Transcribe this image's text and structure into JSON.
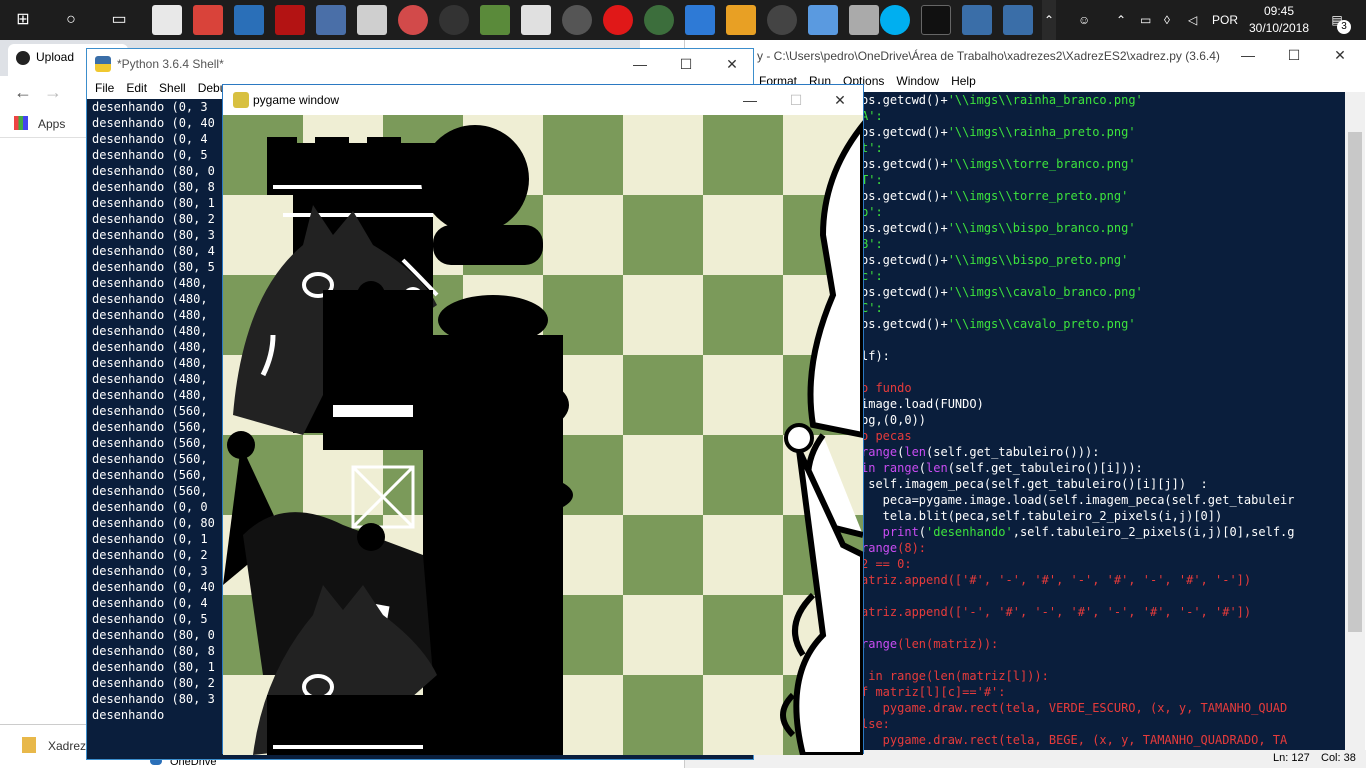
{
  "taskbar": {
    "lang": "POR",
    "time": "09:45",
    "date": "30/10/2018",
    "notifications": "3"
  },
  "chrome": {
    "tab_label": "Upload",
    "bookmarks_apps": "Apps",
    "download_item": "Xadrez",
    "onedrive": "OneDrive"
  },
  "shell": {
    "title": "*Python 3.6.4 Shell*",
    "menu": [
      "File",
      "Edit",
      "Shell",
      "Debu"
    ],
    "lines": [
      "desenhando (0, 3",
      "desenhando (0, 40",
      "desenhando (0, 4",
      "desenhando (0, 5",
      "desenhando (80, 0",
      "desenhando (80, 8",
      "desenhando (80, 1",
      "desenhando (80, 2",
      "desenhando (80, 3",
      "desenhando (80, 4",
      "desenhando (80, 5",
      "desenhando (480,",
      "desenhando (480,",
      "desenhando (480,",
      "desenhando (480,",
      "desenhando (480,",
      "desenhando (480,",
      "desenhando (480,",
      "desenhando (480,",
      "desenhando (560,",
      "desenhando (560,",
      "desenhando (560,",
      "desenhando (560,",
      "desenhando (560,",
      "desenhando (560,",
      "desenhando (0, 0",
      "desenhando (0, 80",
      "desenhando (0, 1",
      "desenhando (0, 2",
      "desenhando (0, 3",
      "desenhando (0, 40",
      "desenhando (0, 4",
      "desenhando (0, 5",
      "desenhando (80, 0",
      "desenhando (80, 8",
      "desenhando (80, 1",
      "desenhando (80, 2",
      "desenhando (80, 3",
      "desenhando"
    ]
  },
  "editor": {
    "title": "y - C:\\Users\\pedro\\OneDrive\\Área de Trabalho\\xadrezes2\\XadrezES2\\xadrez.py (3.6.4)",
    "menu": [
      "Format",
      "Run",
      "Options",
      "Window",
      "Help"
    ],
    "status_ln": "Ln: 127",
    "status_col": "Col: 38",
    "code_lines": [
      [
        [
          "w",
          "os.getcwd()+"
        ],
        [
          "g",
          "'\\\\imgs\\\\rainha_branco.png'"
        ]
      ],
      [
        [
          "g",
          "A':"
        ]
      ],
      [
        [
          "w",
          "os.getcwd()+"
        ],
        [
          "g",
          "'\\\\imgs\\\\rainha_preto.png'"
        ]
      ],
      [
        [
          "g",
          "t':"
        ]
      ],
      [
        [
          "w",
          "os.getcwd()+"
        ],
        [
          "g",
          "'\\\\imgs\\\\torre_branco.png'"
        ]
      ],
      [
        [
          "g",
          "T':"
        ]
      ],
      [
        [
          "w",
          "os.getcwd()+"
        ],
        [
          "g",
          "'\\\\imgs\\\\torre_preto.png'"
        ]
      ],
      [
        [
          "g",
          "b':"
        ]
      ],
      [
        [
          "w",
          "os.getcwd()+"
        ],
        [
          "g",
          "'\\\\imgs\\\\bispo_branco.png'"
        ]
      ],
      [
        [
          "g",
          "B':"
        ]
      ],
      [
        [
          "w",
          "os.getcwd()+"
        ],
        [
          "g",
          "'\\\\imgs\\\\bispo_preto.png'"
        ]
      ],
      [
        [
          "g",
          "c':"
        ]
      ],
      [
        [
          "w",
          "os.getcwd()+"
        ],
        [
          "g",
          "'\\\\imgs\\\\cavalo_branco.png'"
        ]
      ],
      [
        [
          "g",
          "C':"
        ]
      ],
      [
        [
          "w",
          "os.getcwd()+"
        ],
        [
          "g",
          "'\\\\imgs\\\\cavalo_preto.png'"
        ]
      ],
      [
        [
          "w",
          ""
        ]
      ],
      [
        [
          "w",
          "lf):"
        ]
      ],
      [
        [
          "w",
          ""
        ]
      ],
      [
        [
          "r",
          "o fundo"
        ]
      ],
      [
        [
          "w",
          "image.load(FUNDO)"
        ]
      ],
      [
        [
          "w",
          "bg,(0,0))"
        ]
      ],
      [
        [
          "r",
          "o pecas"
        ]
      ],
      [
        [
          "p",
          "range"
        ],
        [
          "w",
          "("
        ],
        [
          "p",
          "len"
        ],
        [
          "w",
          "(self.get_tabuleiro())):"
        ]
      ],
      [
        [
          "p",
          "in range"
        ],
        [
          "w",
          "("
        ],
        [
          "p",
          "len"
        ],
        [
          "w",
          "(self.get_tabuleiro()[i])):"
        ]
      ],
      [
        [
          "w",
          " self.imagem_peca(self.get_tabuleiro()[i][j])  :"
        ]
      ],
      [
        [
          "w",
          "   peca=pygame.image.load(self.imagem_peca(self.get_tabuleir"
        ]
      ],
      [
        [
          "w",
          "   tela.blit(peca,self.tabuleiro_2_pixels(i,j)[0])"
        ]
      ],
      [
        [
          "p",
          "   print"
        ],
        [
          "w",
          "("
        ],
        [
          "g",
          "'desenhando'"
        ],
        [
          "w",
          ",self.tabuleiro_2_pixels(i,j)[0],self.g"
        ]
      ],
      [
        [
          "p",
          "range"
        ],
        [
          "r",
          "(8):"
        ]
      ],
      [
        [
          "r",
          "2 == 0:"
        ]
      ],
      [
        [
          "r",
          "atriz.append(['#', '-', '#', '-', '#', '-', '#', '-'])"
        ]
      ],
      [
        [
          "w",
          ""
        ]
      ],
      [
        [
          "r",
          "atriz.append(['-', '#', '-', '#', '-', '#', '-', '#'])"
        ]
      ],
      [
        [
          "w",
          ""
        ]
      ],
      [
        [
          "p",
          "range"
        ],
        [
          "r",
          "(len(matriz)):"
        ]
      ],
      [
        [
          "w",
          ""
        ]
      ],
      [
        [
          "r",
          " in range(len(matriz[l])):"
        ]
      ],
      [
        [
          "r",
          "f matriz[l][c]=='#':"
        ]
      ],
      [
        [
          "r",
          "   pygame.draw.rect(tela, VERDE_ESCURO, (x, y, TAMANHO_QUAD"
        ]
      ],
      [
        [
          "r",
          "lse:"
        ]
      ],
      [
        [
          "r",
          "   pygame.draw.rect(tela, BEGE, (x, y, TAMANHO_QUADRADO, TA"
        ]
      ]
    ]
  },
  "pygame": {
    "title": "pygame window",
    "colors": {
      "dark": "#7b9a5a",
      "light": "#efeed4"
    }
  }
}
